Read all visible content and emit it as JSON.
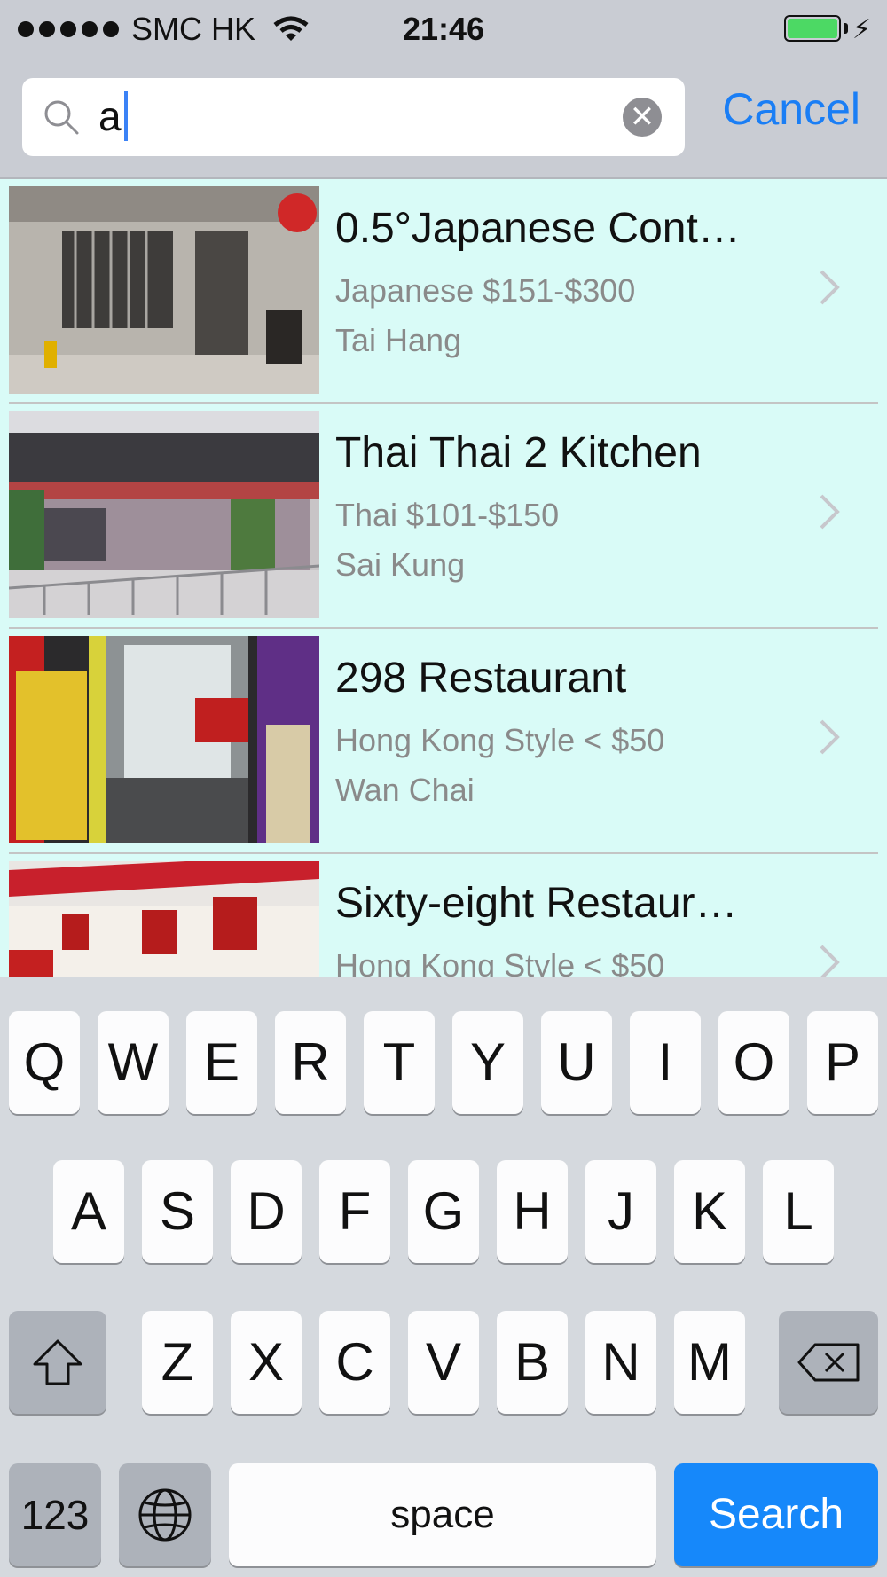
{
  "status_bar": {
    "carrier": "SMC HK",
    "time": "21:46"
  },
  "search": {
    "query": "a",
    "cancel_label": "Cancel"
  },
  "results": [
    {
      "name": "0.5°Japanese Cont…",
      "cuisine_price": "Japanese $151-$300",
      "district": "Tai Hang"
    },
    {
      "name": "Thai Thai 2 Kitchen",
      "cuisine_price": "Thai $101-$150",
      "district": "Sai Kung"
    },
    {
      "name": "298 Restaurant",
      "cuisine_price": "Hong Kong Style < $50",
      "district": "Wan Chai"
    },
    {
      "name": "Sixty-eight Restaur…",
      "cuisine_price": "Hong Kong Style < $50",
      "district": ""
    }
  ],
  "keyboard": {
    "row1": [
      "Q",
      "W",
      "E",
      "R",
      "T",
      "Y",
      "U",
      "I",
      "O",
      "P"
    ],
    "row2": [
      "A",
      "S",
      "D",
      "F",
      "G",
      "H",
      "J",
      "K",
      "L"
    ],
    "row3": [
      "Z",
      "X",
      "C",
      "V",
      "B",
      "N",
      "M"
    ],
    "numbers_label": "123",
    "space_label": "space",
    "search_label": "Search"
  },
  "colors": {
    "accent": "#1a7ef5",
    "results_bg": "#d9fbf7",
    "battery": "#4cd964",
    "search_key": "#1688fa"
  }
}
